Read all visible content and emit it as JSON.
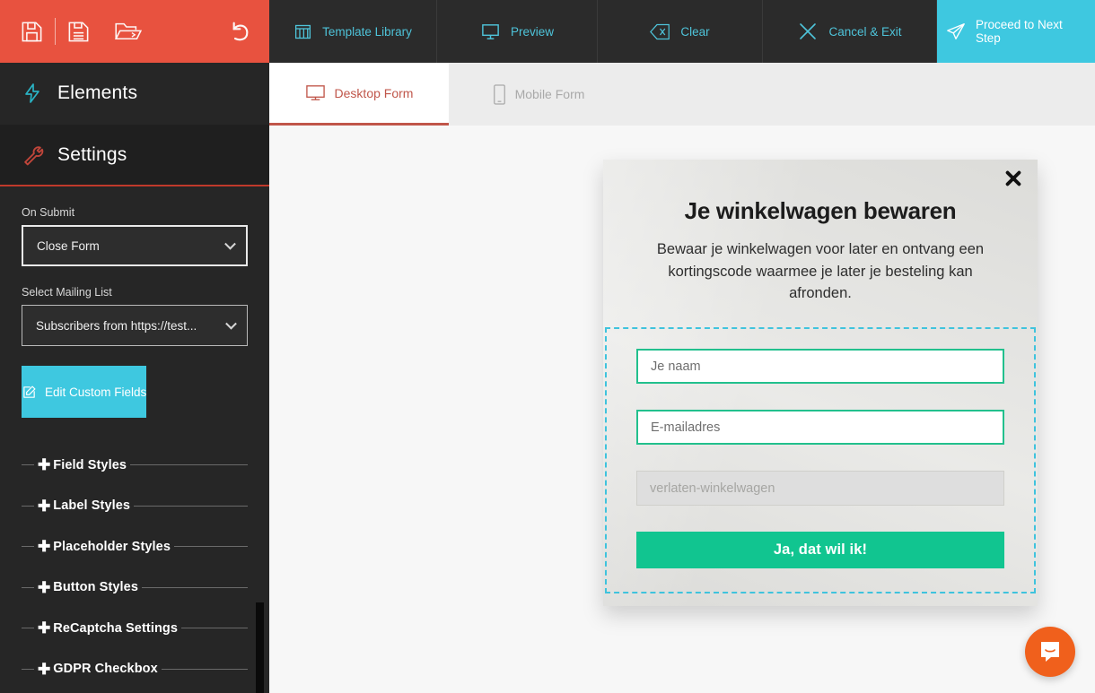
{
  "toolbar": {
    "icons": [
      {
        "name": "save-icon",
        "label": "Save"
      },
      {
        "name": "save-as-icon",
        "label": "Save As"
      },
      {
        "name": "open-folder-icon",
        "label": "Open"
      },
      {
        "name": "undo-icon",
        "label": "Undo"
      }
    ],
    "accent_color": "#e8523f"
  },
  "topbar": {
    "accent_color": "#4ec3d9",
    "proceed_bg": "#3ec8e0",
    "items": [
      {
        "label": "Template Library",
        "icon": "template-library-icon"
      },
      {
        "label": "Preview",
        "icon": "preview-monitor-icon"
      },
      {
        "label": "Clear",
        "icon": "clear-icon"
      },
      {
        "label": "Cancel & Exit",
        "icon": "close-x-icon"
      },
      {
        "label": "Proceed to Next Step",
        "icon": "paper-plane-icon"
      }
    ]
  },
  "sidebar": {
    "nav": [
      {
        "label": "Elements",
        "icon": "lightning-bolt-icon",
        "active": false
      },
      {
        "label": "Settings",
        "icon": "wrench-icon",
        "active": true
      }
    ],
    "settings": {
      "on_submit": {
        "label": "On Submit",
        "value": "Close Form"
      },
      "mailing_list": {
        "label": "Select Mailing List",
        "value": "Subscribers from https://test..."
      },
      "edit_custom_fields": {
        "label": "Edit Custom Fields",
        "icon": "pencil-edit-icon",
        "color": "#3ec8e0"
      },
      "accordions": [
        {
          "label": "Field Styles"
        },
        {
          "label": "Label Styles"
        },
        {
          "label": "Placeholder Styles"
        },
        {
          "label": "Button Styles"
        },
        {
          "label": "ReCaptcha Settings"
        },
        {
          "label": "GDPR Checkbox"
        }
      ]
    }
  },
  "tabs": [
    {
      "label": "Desktop Form",
      "icon": "desktop-monitor-icon",
      "active": true,
      "color": "#c0564a"
    },
    {
      "label": "Mobile Form",
      "icon": "mobile-phone-icon",
      "active": false,
      "color": "#a9a9a9"
    }
  ],
  "modal": {
    "close_icon": "close-x-icon",
    "title": "Je winkelwagen bewaren",
    "subtitle": "Bewaar je winkelwagen voor later en ontvang een kortingscode waarmee je later je besteling kan afronden.",
    "fields": [
      {
        "placeholder": "Je naam",
        "name": "name-field",
        "disabled": false
      },
      {
        "placeholder": "E-mailadres",
        "name": "email-field",
        "disabled": false
      },
      {
        "placeholder": "verlaten-winkelwagen",
        "name": "tag-field",
        "disabled": true
      }
    ],
    "submit_label": "Ja, dat wil ik!",
    "submit_color": "#11c590",
    "selection_border_color": "#3fc3dd"
  },
  "chat": {
    "icon": "intercom-chat-icon",
    "color": "#f0601c"
  }
}
